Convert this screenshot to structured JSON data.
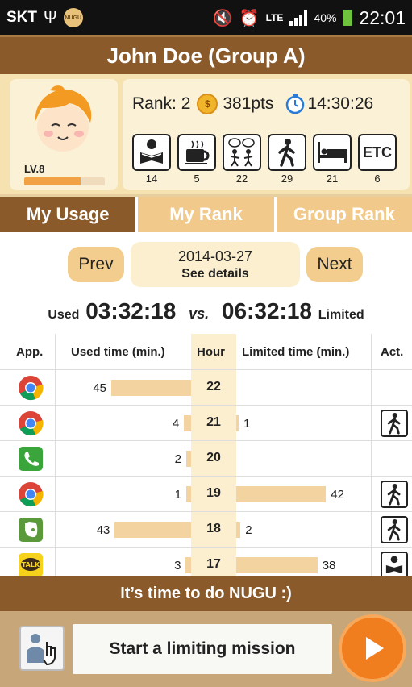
{
  "status_bar": {
    "carrier": "SKT",
    "app_badge": "NUGU",
    "network": "LTE",
    "battery": "40%",
    "time": "22:01"
  },
  "header": {
    "title": "John Doe (Group A)"
  },
  "profile": {
    "level": "LV.8",
    "level_progress": 0.7,
    "rank_label": "Rank: 2",
    "coin_symbol": "$",
    "points": "381pts",
    "elapsed": "14:30:26",
    "activities": [
      {
        "name": "study",
        "icon": "reading-icon",
        "count": "14"
      },
      {
        "name": "coffee",
        "icon": "coffee-icon",
        "count": "5"
      },
      {
        "name": "talk",
        "icon": "conversation-icon",
        "count": "22"
      },
      {
        "name": "walk",
        "icon": "walking-icon",
        "count": "29"
      },
      {
        "name": "sleep",
        "icon": "bed-icon",
        "count": "21"
      },
      {
        "name": "etc",
        "icon": "etc-icon",
        "label": "ETC",
        "count": "6"
      }
    ]
  },
  "tabs": [
    {
      "label": "My Usage",
      "active": true
    },
    {
      "label": "My Rank",
      "active": false
    },
    {
      "label": "Group Rank",
      "active": false
    }
  ],
  "date_nav": {
    "prev": "Prev",
    "date": "2014-03-27",
    "details": "See details",
    "next": "Next"
  },
  "summary": {
    "used_label": "Used",
    "used": "03:32:18",
    "vs": "vs.",
    "limited": "06:32:18",
    "limited_label": "Limited"
  },
  "table": {
    "headers": {
      "app": "App.",
      "used": "Used time (min.)",
      "hour": "Hour",
      "limited": "Limited time (min.)",
      "act": "Act."
    },
    "rows": [
      {
        "app": "chrome",
        "used": 45,
        "hour": "22",
        "limited": null,
        "act": null
      },
      {
        "app": "chrome",
        "used": 4,
        "hour": "21",
        "limited": 1,
        "act": "walking"
      },
      {
        "app": "phone",
        "used": 2,
        "hour": "20",
        "limited": null,
        "act": null
      },
      {
        "app": "chrome",
        "used": 1,
        "hour": "19",
        "limited": 42,
        "act": "walking"
      },
      {
        "app": "evernote",
        "used": 43,
        "hour": "18",
        "limited": 2,
        "act": "walking"
      },
      {
        "app": "kakaotalk",
        "used": 3,
        "hour": "17",
        "limited": 38,
        "act": "reading"
      }
    ]
  },
  "banner": {
    "text": "It’s time to do NUGU :)"
  },
  "footer": {
    "mission": "Start a limiting mission"
  },
  "colors": {
    "brown": "#8a5a2b",
    "cream": "#f6e2b0",
    "bar": "#f3d3a0",
    "orange": "#f07d1e"
  }
}
